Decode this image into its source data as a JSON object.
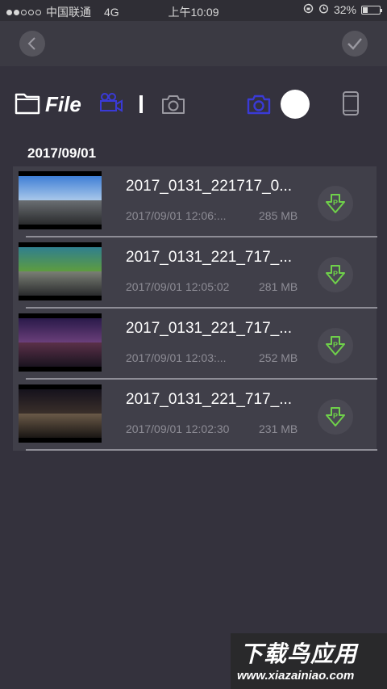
{
  "status_bar": {
    "carrier": "中国联通",
    "network": "4G",
    "time": "上午10:09",
    "battery": "32%",
    "battery_level": 0.32
  },
  "colors": {
    "accent": "#3a3ad6",
    "download": "#6fd14a",
    "background": "#34323d",
    "row_background": "#403f49"
  },
  "nav": {
    "back_icon": "chevron-left-icon",
    "confirm_icon": "checkmark-icon"
  },
  "toolbar": {
    "title": "File",
    "icons": [
      "folder-icon",
      "video-camera-icon",
      "camera-icon",
      "camera-icon-active",
      "record-dot-icon",
      "phone-icon"
    ]
  },
  "group": {
    "date": "2017/09/01"
  },
  "files": [
    {
      "name": "2017_0131_221717_0...",
      "date": "2017/09/01 12:06:...",
      "size": "285 MB",
      "icon": "download-icon"
    },
    {
      "name": "2017_0131_221_717_...",
      "date": "2017/09/01 12:05:02",
      "size": "281 MB",
      "icon": "download-icon"
    },
    {
      "name": "2017_0131_221_717_...",
      "date": "2017/09/01 12:03:...",
      "size": "252 MB",
      "icon": "download-icon"
    },
    {
      "name": "2017_0131_221_717_...",
      "date": "2017/09/01 12:02:30",
      "size": "231 MB",
      "icon": "download-icon"
    }
  ],
  "watermark": {
    "title": "下载鸟应用",
    "url": "www.xiazainiao.com"
  }
}
